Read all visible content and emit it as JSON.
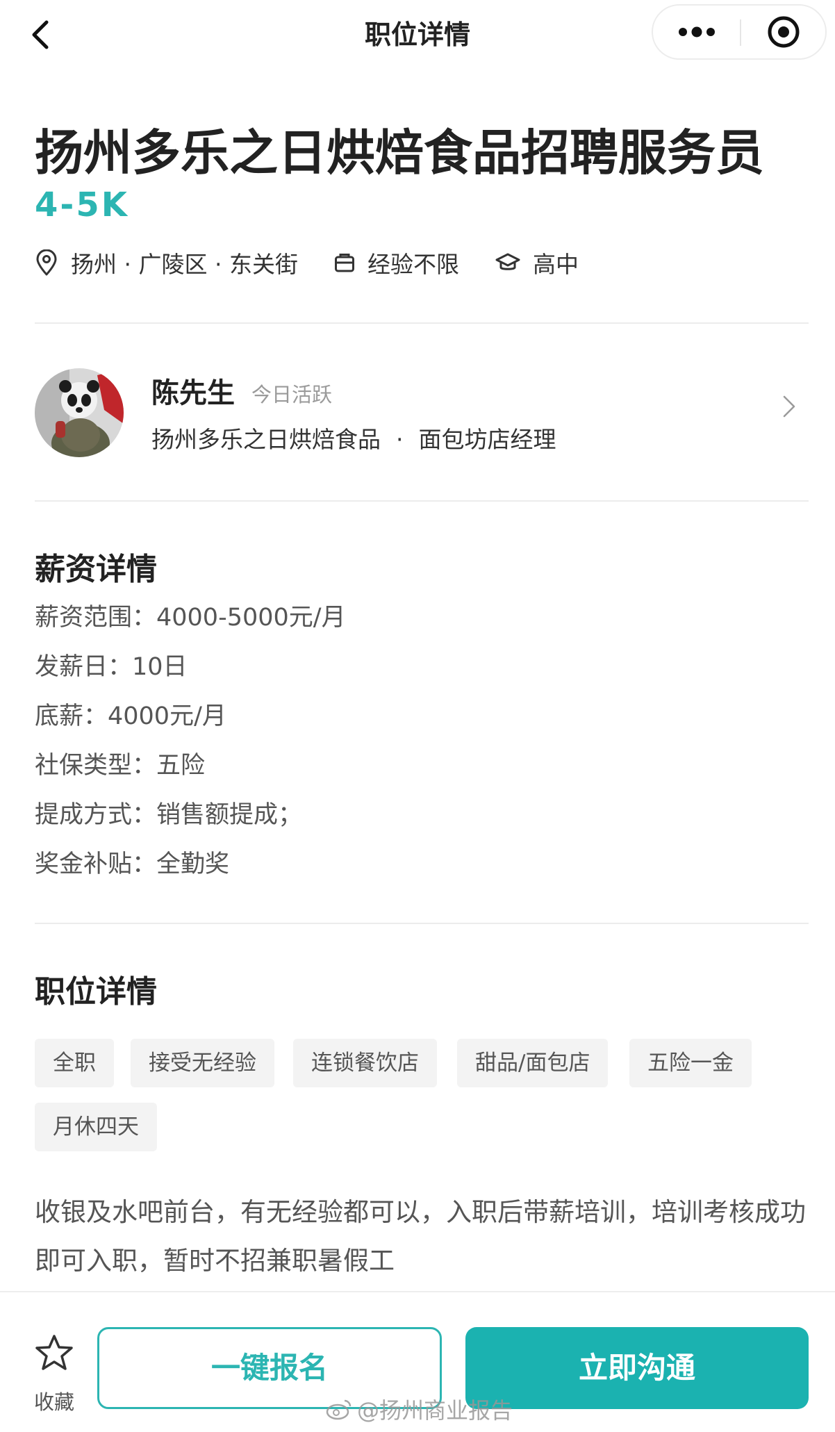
{
  "navbar": {
    "title": "职位详情"
  },
  "job": {
    "title": "扬州多乐之日烘焙食品招聘服务员",
    "salary": "4-5K",
    "location": "扬州 · 广陵区 · 东关街",
    "experience": "经验不限",
    "education": "高中"
  },
  "recruiter": {
    "name": "陈先生",
    "status": "今日活跃",
    "company": "扬州多乐之日烘焙食品",
    "separator": "·",
    "position": "面包坊店经理"
  },
  "salary_details": {
    "heading": "薪资详情",
    "lines": [
      "薪资范围：4000-5000元/月",
      "发薪日：10日",
      "底薪：4000元/月",
      "社保类型：五险",
      "提成方式：销售额提成；",
      "奖金补贴：全勤奖"
    ]
  },
  "job_details": {
    "heading": "职位详情",
    "tags": [
      "全职",
      "接受无经验",
      "连锁餐饮店",
      "甜品/面包店",
      "五险一金",
      "月休四天"
    ],
    "description": "收银及水吧前台，有无经验都可以，入职后带薪培训，培训考核成功即可入职，暂时不招兼职暑假工"
  },
  "bottom_bar": {
    "favorite_label": "收藏",
    "apply_label": "一键报名",
    "chat_label": "立即沟通",
    "watermark": "@扬州商业报告"
  },
  "colors": {
    "accent": "#2cb5b2",
    "button_fill": "#1bb2b0",
    "tag_bg": "#f3f3f3"
  },
  "icons": {
    "back": "chevron-left-icon",
    "more": "more-dots-icon",
    "close": "target-circle-icon",
    "location": "location-pin-icon",
    "experience": "briefcase-icon",
    "education": "graduation-cap-icon",
    "recruiter_arrow": "chevron-right-icon",
    "favorite": "star-icon",
    "watermark": "weibo-icon"
  }
}
